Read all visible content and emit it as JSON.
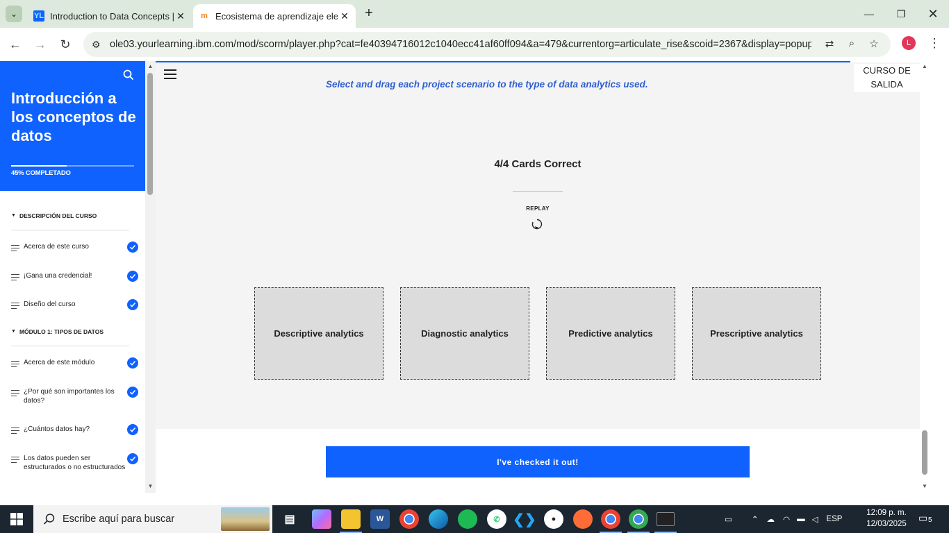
{
  "browser": {
    "tabs": [
      {
        "title": "Introduction to Data Concepts |",
        "favicon": "ibm-yourlearning-icon",
        "active": false
      },
      {
        "title": "Ecosistema de aprendizaje elect",
        "favicon": "moodle-icon",
        "active": true
      }
    ],
    "url": "ole03.yourlearning.ibm.com/mod/scorm/player.php?cat=fe40394716012c1040ecc41af60ff094&a=479&currentorg=articulate_rise&scoid=2367&display=popup&...",
    "profile_initial": "L",
    "accent": "#0f62fe"
  },
  "sidebar": {
    "course_title": "Introducción a los conceptos de datos",
    "progress_label": "45% COMPLETADO",
    "progress_value": 0.45,
    "sections": [
      {
        "title": "DESCRIPCIÓN DEL CURSO",
        "items": [
          {
            "label": "Acerca de este curso",
            "done": true
          },
          {
            "label": "¡Gana una credencial!",
            "done": true
          },
          {
            "label": "Diseño del curso",
            "done": true
          }
        ]
      },
      {
        "title": "MÓDULO 1: TIPOS DE DATOS",
        "items": [
          {
            "label": "Acerca de este módulo",
            "done": true
          },
          {
            "label": "¿Por qué son importantes los datos?",
            "done": true
          },
          {
            "label": "¿Cuántos datos hay?",
            "done": true
          },
          {
            "label": "Los datos pueden ser estructurados o no estructurados",
            "done": true
          }
        ]
      }
    ]
  },
  "main": {
    "exit_label": "CURSO DE SALIDA",
    "instruction": "Select and drag each project scenario to the type of data analytics used.",
    "score": "4/4 Cards Correct",
    "replay_label": "REPLAY",
    "categories": [
      "Descriptive analytics",
      "Diagnostic analytics",
      "Predictive analytics",
      "Prescriptive analytics"
    ],
    "continue_label": "I've checked it out!"
  },
  "taskbar": {
    "search_placeholder": "Escribe aquí para buscar",
    "language": "ESP",
    "time": "12:09 p. m.",
    "date": "12/03/2025",
    "notifications": "5"
  }
}
